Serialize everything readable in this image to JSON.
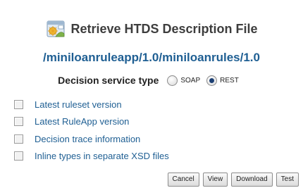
{
  "header": {
    "title": "Retrieve HTDS Description File",
    "icon": "deploy-icon"
  },
  "path": "/miniloanruleapp/1.0/miniloanrules/1.0",
  "service_type": {
    "label": "Decision service type",
    "options": [
      {
        "label": "SOAP",
        "selected": false
      },
      {
        "label": "REST",
        "selected": true
      }
    ]
  },
  "options": [
    {
      "label": "Latest ruleset version",
      "checked": false
    },
    {
      "label": "Latest RuleApp version",
      "checked": false
    },
    {
      "label": "Decision trace information",
      "checked": false
    },
    {
      "label": "Inline types in separate XSD files",
      "checked": false
    }
  ],
  "buttons": {
    "cancel": "Cancel",
    "view": "View",
    "download": "Download",
    "test": "Test"
  },
  "colors": {
    "link_blue": "#1f5f93",
    "title_gray": "#3d3d3d"
  }
}
